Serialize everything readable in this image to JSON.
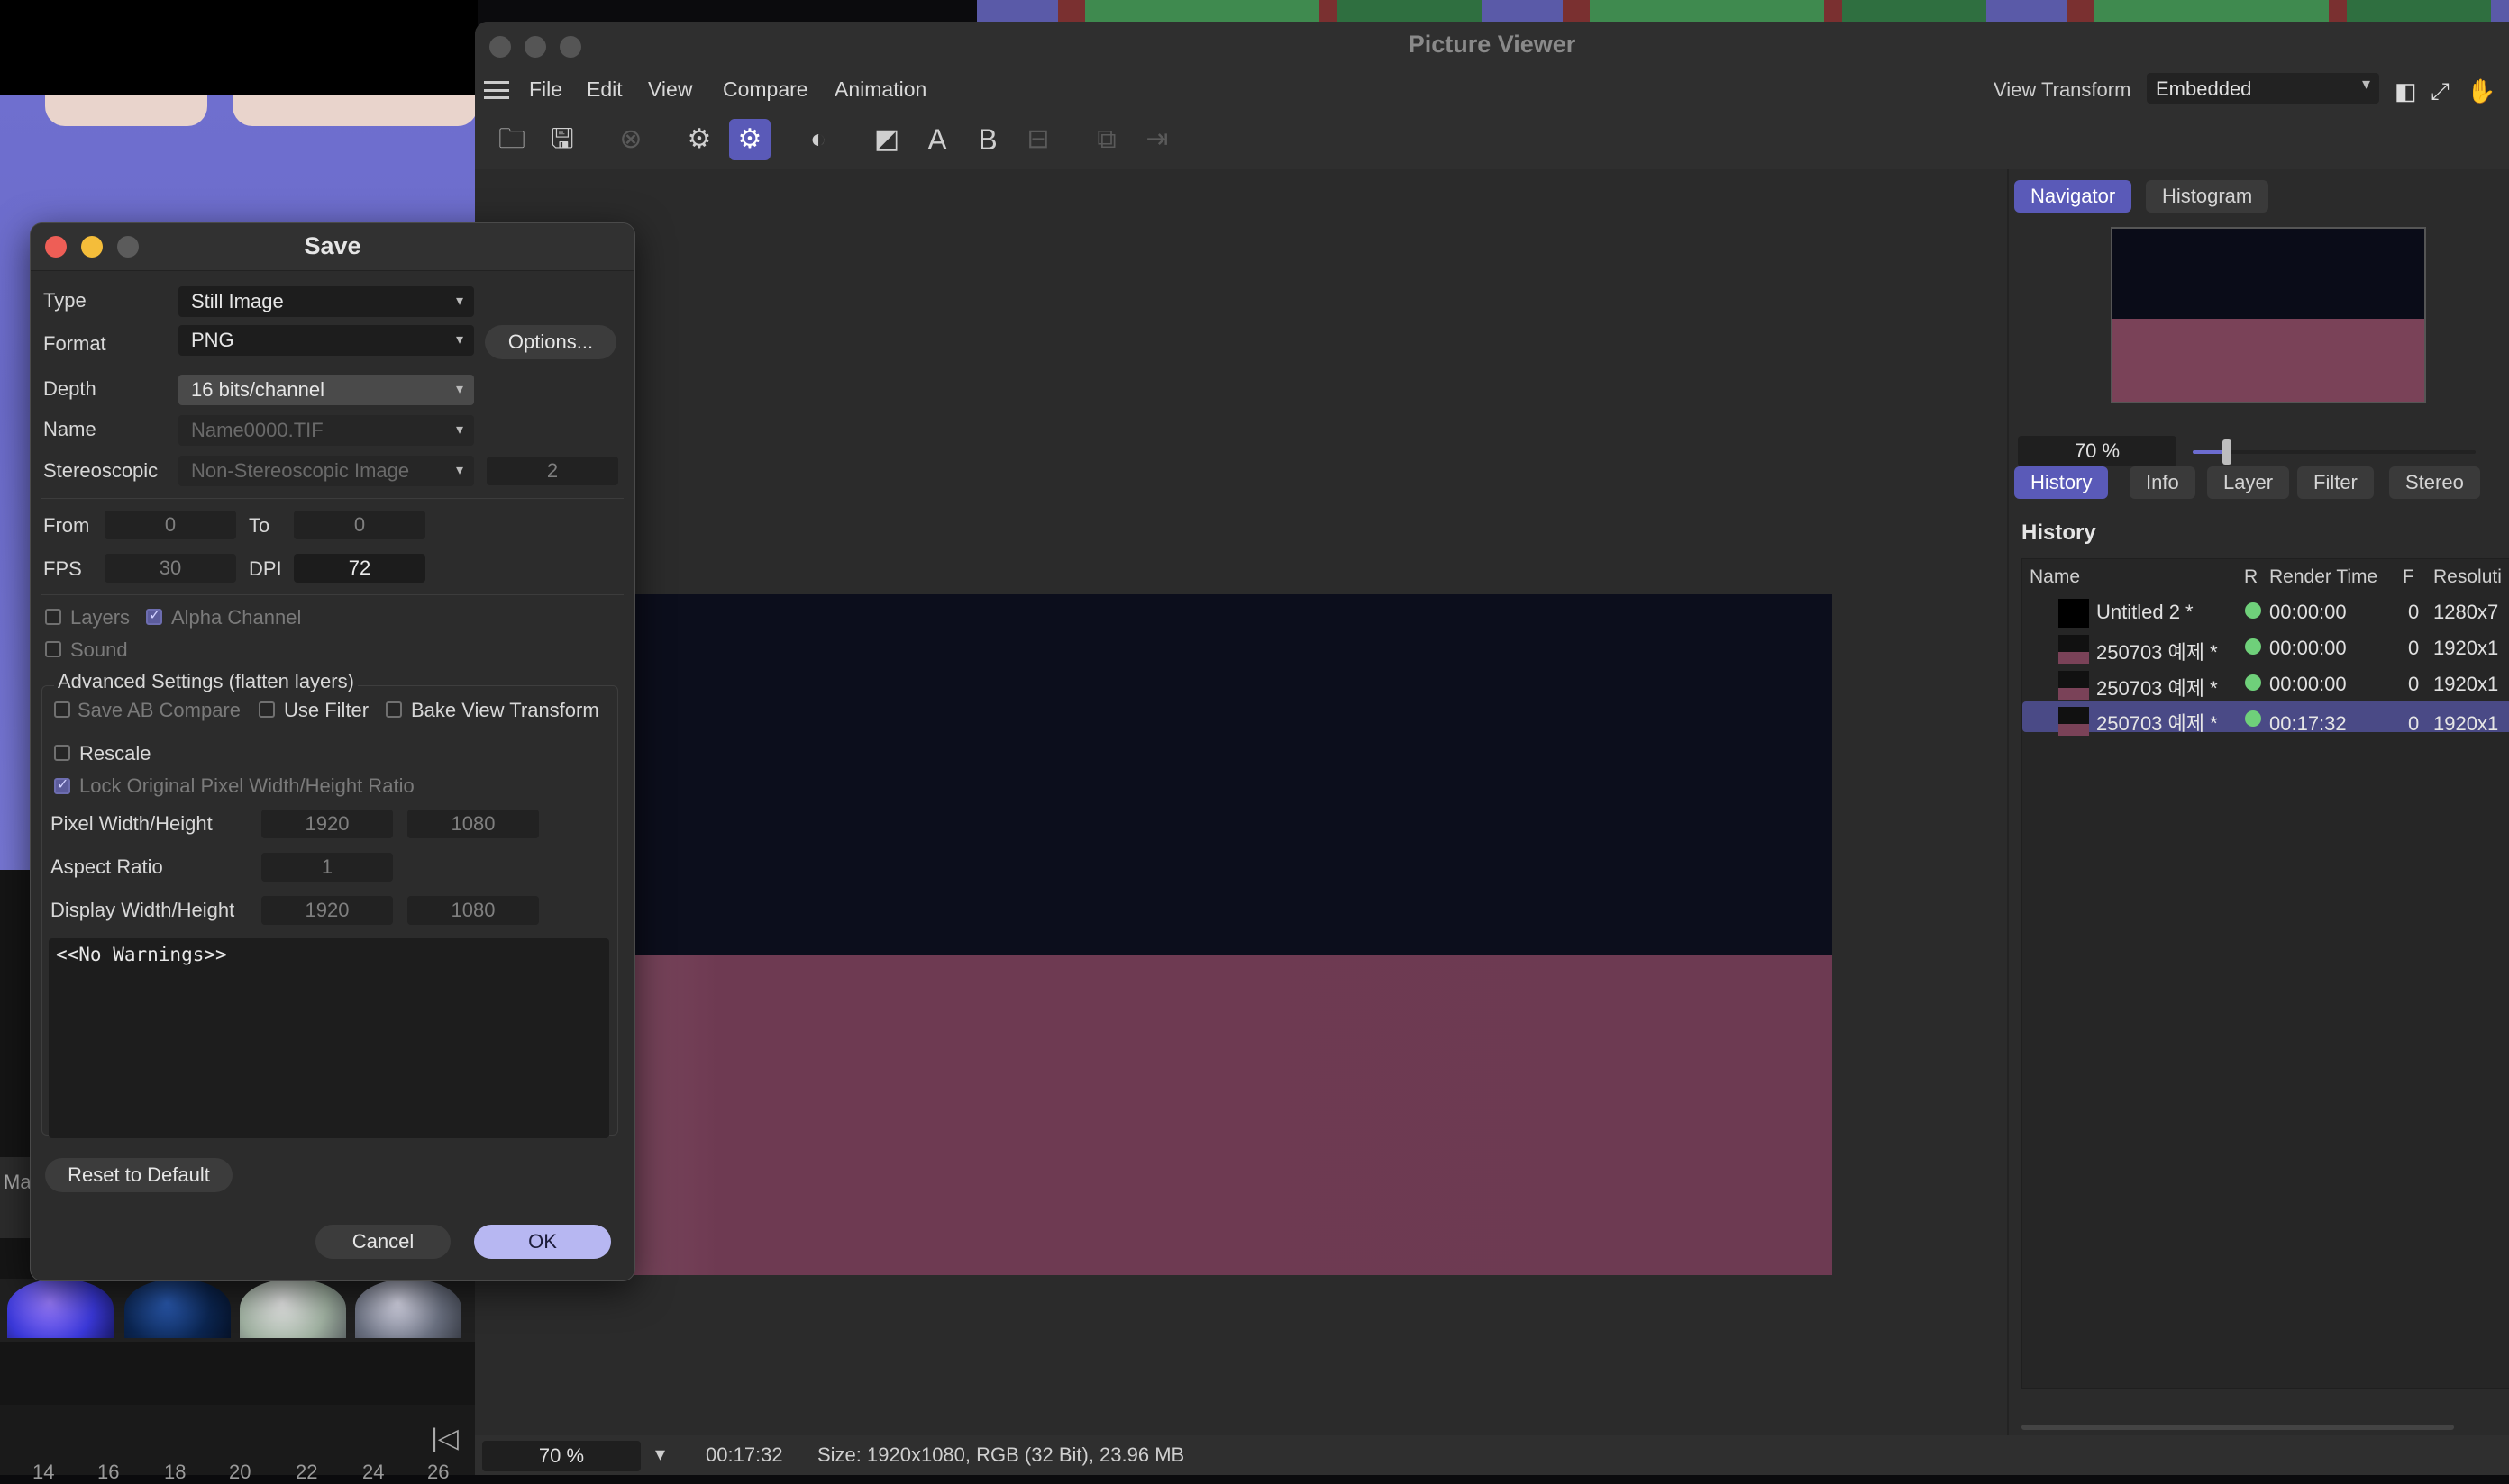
{
  "viewer": {
    "title": "Picture Viewer",
    "menu": [
      "File",
      "Edit",
      "View",
      "Compare",
      "Animation"
    ],
    "view_transform_label": "View Transform",
    "view_transform_value": "Embedded",
    "toolbar_icons": [
      "open-folder-icon",
      "save-icon",
      "stop-icon",
      "region-render-icon",
      "interactive-render-icon",
      "contrast-icon",
      "ab-compare-icon",
      "a-icon",
      "b-icon",
      "swap-icon",
      "layer-copy-icon",
      "export-icon"
    ],
    "nav_tabs": [
      "Navigator",
      "Histogram"
    ],
    "zoom": "70 %",
    "zoom_fraction": 0.12,
    "panel_tabs": [
      "History",
      "Info",
      "Layer",
      "Filter",
      "Stereo"
    ],
    "history_title": "History",
    "history_headers": [
      "Name",
      "R",
      "Render Time",
      "F",
      "Resoluti"
    ],
    "history_rows": [
      {
        "name": "Untitled 2 *",
        "time": "00:00:00",
        "frame": "0",
        "res": "1280x7"
      },
      {
        "name": "250703 예제 *",
        "time": "00:00:00",
        "frame": "0",
        "res": "1920x1"
      },
      {
        "name": "250703 예제 *",
        "time": "00:00:00",
        "frame": "0",
        "res": "1920x1"
      },
      {
        "name": "250703 예제 *",
        "time": "00:17:32",
        "frame": "0",
        "res": "1920x1"
      }
    ],
    "status_zoom": "70 %",
    "status_time": "00:17:32",
    "status_size": "Size: 1920x1080, RGB (32 Bit), 23.96 MB"
  },
  "dialog": {
    "title": "Save",
    "type_label": "Type",
    "type_value": "Still Image",
    "format_label": "Format",
    "format_value": "PNG",
    "options_button": "Options...",
    "depth_label": "Depth",
    "depth_value": "16 bits/channel",
    "name_label": "Name",
    "name_value": "Name0000.TIF",
    "stereo_label": "Stereoscopic",
    "stereo_value": "Non-Stereoscopic Image",
    "stereo_count": "2",
    "from_label": "From",
    "from_value": "0",
    "to_label": "To",
    "to_value": "0",
    "fps_label": "FPS",
    "fps_value": "30",
    "dpi_label": "DPI",
    "dpi_value": "72",
    "layers_label": "Layers",
    "alpha_label": "Alpha Channel",
    "sound_label": "Sound",
    "advanced_label": "Advanced Settings (flatten layers)",
    "save_ab_label": "Save AB Compare",
    "use_filter_label": "Use Filter",
    "bake_vt_label": "Bake View Transform",
    "rescale_label": "Rescale",
    "lock_ratio_label": "Lock Original Pixel Width/Height Ratio",
    "pixel_wh_label": "Pixel Width/Height",
    "pixel_w": "1920",
    "pixel_h": "1080",
    "aspect_label": "Aspect Ratio",
    "aspect_value": "1",
    "display_wh_label": "Display Width/Height",
    "display_w": "1920",
    "display_h": "1080",
    "warnings": "<<No Warnings>>",
    "reset_button": "Reset to Default",
    "cancel_button": "Cancel",
    "ok_button": "OK"
  },
  "background": {
    "left_label": "Ma",
    "ruler": [
      "14",
      "16",
      "18",
      "20",
      "22",
      "24",
      "26"
    ]
  },
  "colors": {
    "accent": "#5a5ab8",
    "ok_button": "#b7b7f2",
    "status_dot": "#6fd07a",
    "render_bottom": "#6d3a52"
  }
}
